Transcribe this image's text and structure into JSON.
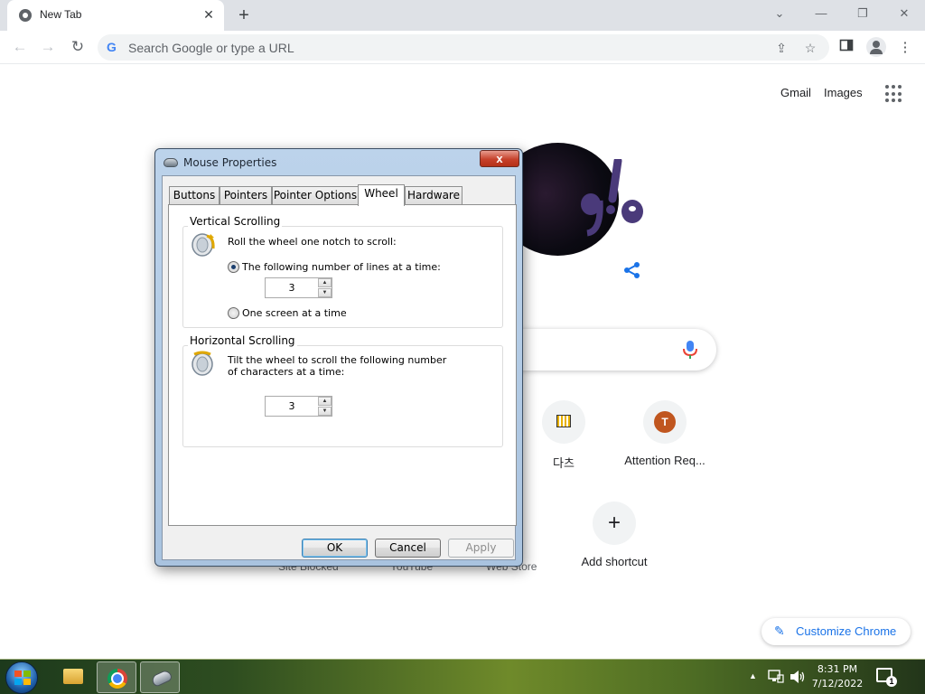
{
  "browser": {
    "tab": {
      "title": "New Tab",
      "close": "✕"
    },
    "new_tab": "+",
    "window_controls": {
      "tab_search": "⌄",
      "minimize": "—",
      "restore": "❐",
      "close": "✕"
    },
    "nav": {
      "back": "←",
      "forward": "→",
      "reload": "↻"
    },
    "omnibox": {
      "placeholder": "Search Google or type a URL"
    },
    "toolbar": {
      "share": "⇪",
      "bookmark": "☆",
      "more": "⋮"
    }
  },
  "ntp": {
    "gmail": "Gmail",
    "images": "Images",
    "shortcuts": [
      {
        "label": "다츠"
      },
      {
        "label": "Attention Req...",
        "badge": "T"
      },
      {
        "label": "Add shortcut",
        "icon": "+"
      }
    ],
    "hidden_shortcut_labels": [
      "Site Blocked",
      "YouTube",
      "Web Store"
    ],
    "customize": "Customize Chrome"
  },
  "dialog": {
    "title": "Mouse Properties",
    "close": "x",
    "tabs": [
      "Buttons",
      "Pointers",
      "Pointer Options",
      "Wheel",
      "Hardware"
    ],
    "selected_tab": "Wheel",
    "vertical": {
      "heading": "Vertical Scrolling",
      "instruction": "Roll the wheel one notch to scroll:",
      "option_lines": "The following number of lines at a time:",
      "lines_value": "3",
      "option_screen": "One screen at a time",
      "selected_option": "lines"
    },
    "horizontal": {
      "heading": "Horizontal Scrolling",
      "instruction_line1": "Tilt the wheel to scroll the following number",
      "instruction_line2": "of characters at a time:",
      "chars_value": "3"
    },
    "buttons": {
      "ok": "OK",
      "cancel": "Cancel",
      "apply": "Apply"
    },
    "spinner_up": "▲",
    "spinner_down": "▼"
  },
  "taskbar": {
    "tray_arrow": "▲",
    "time": "8:31 PM",
    "date": "7/12/2022",
    "notification_count": "1"
  }
}
